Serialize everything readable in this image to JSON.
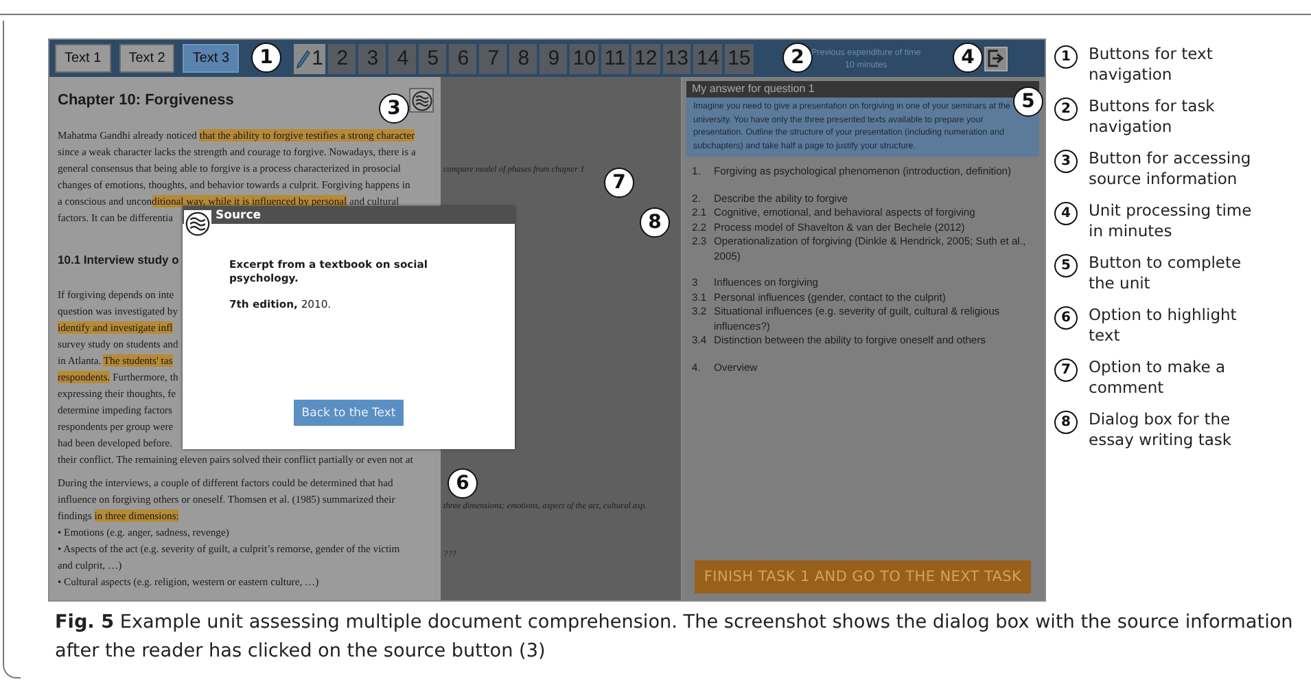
{
  "toolbar": {
    "text_tabs": [
      {
        "label": "Text 1",
        "selected": false
      },
      {
        "label": "Text 2",
        "selected": false
      },
      {
        "label": "Text 3",
        "selected": true
      }
    ],
    "task_buttons": [
      {
        "label": "1",
        "selected": true
      },
      {
        "label": "2",
        "selected": false
      },
      {
        "label": "3",
        "selected": false
      },
      {
        "label": "4",
        "selected": false
      },
      {
        "label": "5",
        "selected": false
      },
      {
        "label": "6",
        "selected": false
      },
      {
        "label": "7",
        "selected": false
      },
      {
        "label": "8",
        "selected": false
      },
      {
        "label": "9",
        "selected": false
      },
      {
        "label": "10",
        "selected": false
      },
      {
        "label": "11",
        "selected": false
      },
      {
        "label": "12",
        "selected": false
      },
      {
        "label": "13",
        "selected": false
      },
      {
        "label": "14",
        "selected": false
      },
      {
        "label": "15",
        "selected": false
      }
    ],
    "time": {
      "label": "Previous expenditure of time",
      "value": "10 minutes"
    }
  },
  "text_panel": {
    "title": "Chapter 10: Forgiveness",
    "blocks": [
      {
        "kind": "paragraph",
        "lines": [
          [
            {
              "text": "Mahatma Gandhi already noticed ",
              "highlighted": false
            },
            {
              "text": "that the ability to forgive testifies a strong character",
              "highlighted": true
            }
          ],
          [
            {
              "text": "since a weak character lacks the strength and courage to forgive. Nowadays, there is a",
              "highlighted": false
            }
          ],
          [
            {
              "text": "general consensus that being able to forgive is a process characterized in prosocial",
              "highlighted": false
            }
          ],
          [
            {
              "text": "changes of emotions, thoughts, and behavior towards a culprit. Forgiving happens in",
              "highlighted": false
            }
          ],
          [
            {
              "text": "a conscious and uncon",
              "highlighted": false
            },
            {
              "text": "ditional way, while it is influenced by personal",
              "highlighted": true
            },
            {
              "text": " and cultural",
              "highlighted": false
            }
          ],
          [
            {
              "text": "factors. It can be differentia",
              "highlighted": false
            }
          ]
        ]
      },
      {
        "kind": "heading",
        "lines": [
          [
            {
              "text": "10.1 Interview study o",
              "highlighted": false
            }
          ]
        ]
      },
      {
        "kind": "paragraph",
        "lines": [
          [
            {
              "text": "If forgiving depends on inte",
              "highlighted": false
            }
          ],
          [
            {
              "text": "question was investigated by",
              "highlighted": false
            }
          ],
          [
            {
              "text": "identify and investigate infl",
              "highlighted": true
            }
          ],
          [
            {
              "text": "survey study on students and",
              "highlighted": false
            }
          ],
          [
            {
              "text": "in Atlanta. ",
              "highlighted": false
            },
            {
              "text": "The students' tas",
              "highlighted": true
            }
          ],
          [
            {
              "text": "respondents.",
              "highlighted": true
            },
            {
              "text": " Furthermore, th",
              "highlighted": false
            }
          ],
          [
            {
              "text": "expressing their thoughts, fe",
              "highlighted": false
            }
          ],
          [
            {
              "text": "determine impeding factors",
              "highlighted": false
            }
          ],
          [
            {
              "text": "respondents per group were",
              "highlighted": false
            }
          ],
          [
            {
              "text": "had been developed before.",
              "highlighted": false
            }
          ],
          [
            {
              "text": "their conflict. The remaining eleven pairs solved their conflict partially or even not at",
              "highlighted": false
            }
          ]
        ]
      },
      {
        "kind": "paragraph",
        "lines": [
          [
            {
              "text": "During the interviews, a couple of different factors could be determined that had",
              "highlighted": false
            }
          ],
          [
            {
              "text": "influence on forgiving others or oneself. Thomsen et al. (1985) summarized their",
              "highlighted": false
            }
          ],
          [
            {
              "text": "findings ",
              "highlighted": false
            },
            {
              "text": "in three dimensions:",
              "highlighted": true
            }
          ],
          [
            {
              "text": "• Emotions (e.g. anger, sadness, revenge)",
              "highlighted": false
            }
          ],
          [
            {
              "text": "• Aspects of the act (e.g. severity of guilt, a culprit’s remorse, gender of the victim",
              "highlighted": false
            }
          ],
          [
            {
              "text": "and culprit, …)",
              "highlighted": false
            }
          ],
          [
            {
              "text": "• Cultural aspects (e.g. religion, western or eastern culture, …)",
              "highlighted": false
            }
          ]
        ]
      }
    ]
  },
  "comments": [
    "compare model of phases from chapter 1",
    "three dimensions: emotions, aspect of the act, cultural asp.",
    "???"
  ],
  "answer_panel": {
    "title": "My answer for question 1",
    "prompt": "Imagine you need to give a presentation on forgiving in one of your seminars at the university. You have only the three presented texts available to prepare your presentation. Outline the structure of your presentation (including numeration and subchapters) and take half a page to justify your structure.",
    "outline": [
      [
        {
          "num": "1.",
          "text": "Forgiving as psychological phenomenon (introduction, definition)"
        }
      ],
      [
        {
          "num": "2.",
          "text": "Describe the ability to forgive"
        },
        {
          "num": "2.1",
          "text": "Cognitive, emotional, and behavioral aspects of forgiving"
        },
        {
          "num": "2.2",
          "text": "Process model of Shavelton & van der Bechele (2012)"
        },
        {
          "num": "2.3",
          "text": "Operationalization of forgiving (Dinkle & Hendrick, 2005; Suth et al., 2005)"
        }
      ],
      [
        {
          "num": "3",
          "text": "Influences on forgiving"
        },
        {
          "num": "3.1",
          "text": "Personal influences (gender, contact to the culprit)"
        },
        {
          "num": "3.2",
          "text": "Situational influences (e.g. severity of guilt, cultural & religious influences?)"
        },
        {
          "num": "3.4",
          "text": "Distinction between the ability to forgive oneself and others"
        }
      ],
      [
        {
          "num": "4.",
          "text": "Overview"
        }
      ]
    ],
    "finish_button": "FINISH TASK 1 AND GO TO THE NEXT TASK"
  },
  "source_dialog": {
    "title": "Source",
    "description": "Excerpt from a textbook on social psychology.",
    "edition": "**7th edition,** 2010.",
    "back_button": "Back to the Text"
  },
  "callouts": [
    "1",
    "2",
    "3",
    "4",
    "5",
    "6",
    "7",
    "8"
  ],
  "legend": [
    {
      "num": "1",
      "text": "Buttons for text navigation"
    },
    {
      "num": "2",
      "text": "Buttons for task navigation"
    },
    {
      "num": "3",
      "text": "Button for accessing source information"
    },
    {
      "num": "4",
      "text": "Unit processing time in minutes"
    },
    {
      "num": "5",
      "text": "Button to complete the unit"
    },
    {
      "num": "6",
      "text": "Option to highlight text"
    },
    {
      "num": "7",
      "text": "Option to make a comment"
    },
    {
      "num": "8",
      "text": "Dialog box for the essay writing task"
    }
  ],
  "caption": "**Fig. 5**  Example unit assessing multiple document comprehension. The screenshot shows the dialog box with the source information after the reader has clicked on the source button (3)"
}
